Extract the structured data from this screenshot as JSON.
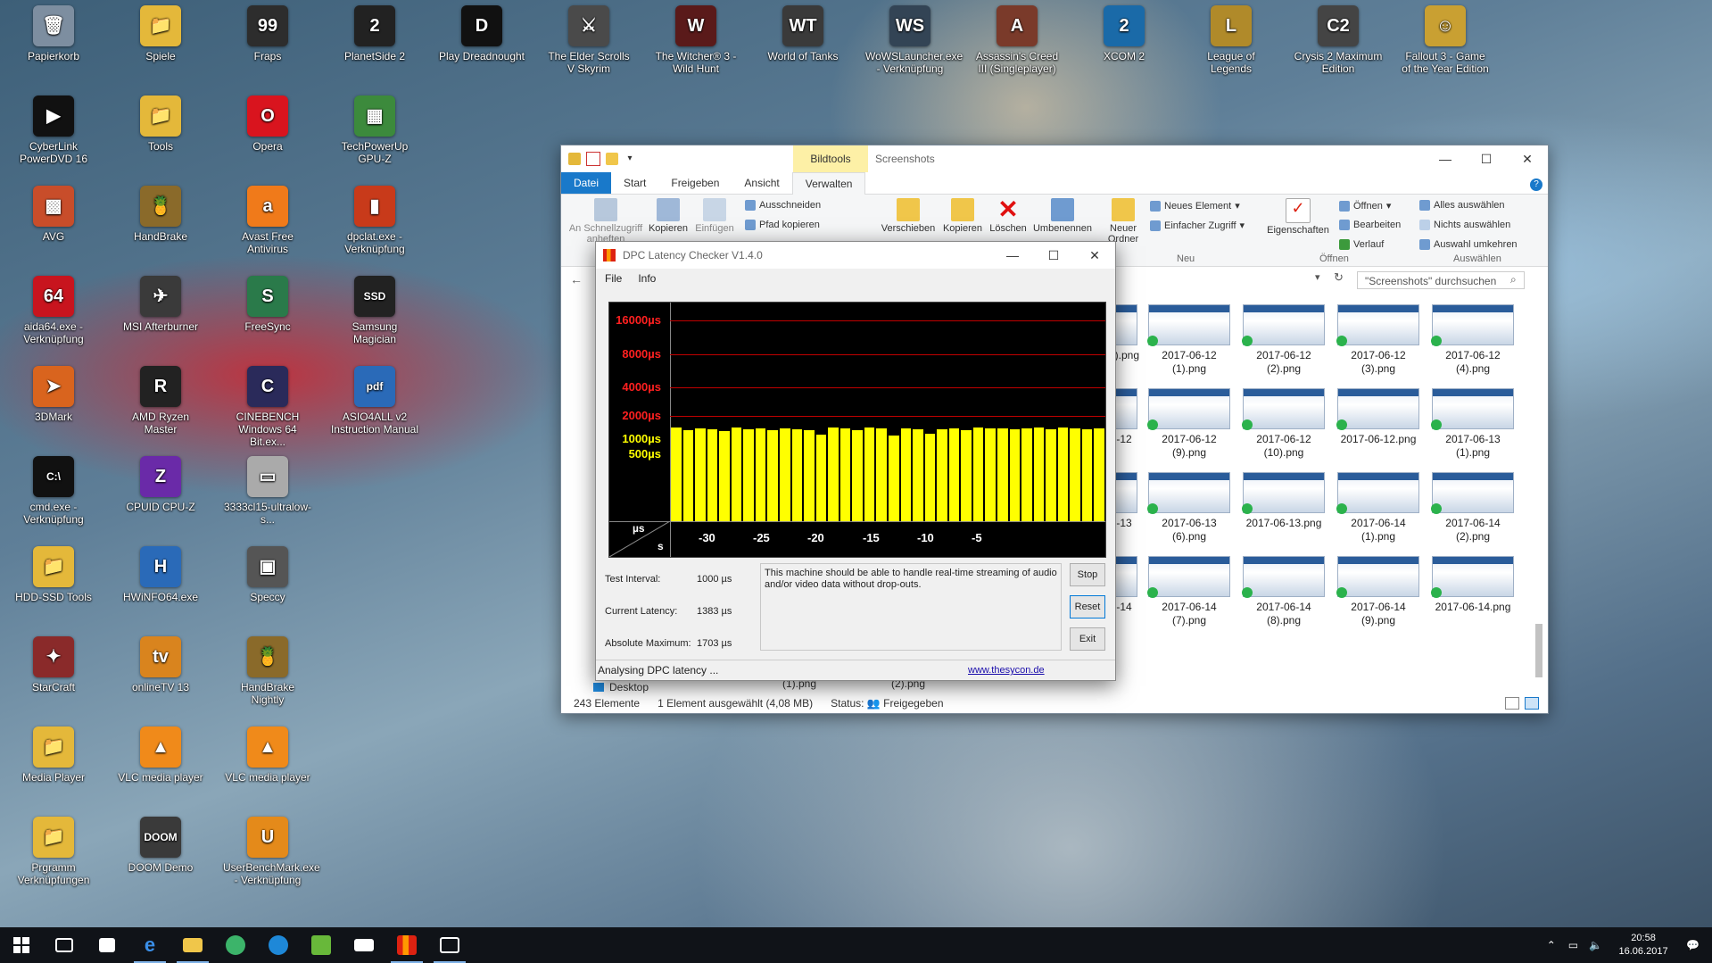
{
  "desktop_icons": [
    {
      "label": "Papierkorb",
      "glyph": "🗑",
      "color": "#7d8ea0"
    },
    {
      "label": "Spiele",
      "glyph": "📁",
      "color": "#e4b83a"
    },
    {
      "label": "Fraps",
      "glyph": "99",
      "color": "#2d2d2d"
    },
    {
      "label": "PlanetSide 2",
      "glyph": "2",
      "color": "#222"
    },
    {
      "label": "Play Dreadnought",
      "glyph": "D",
      "color": "#111"
    },
    {
      "label": "The Elder Scrolls V Skyrim",
      "glyph": "⚔",
      "color": "#4a4a4a"
    },
    {
      "label": "The Witcher® 3 - Wild Hunt",
      "glyph": "W",
      "color": "#5a1a1a"
    },
    {
      "label": "World of Tanks",
      "glyph": "WT",
      "color": "#3a3a3a"
    },
    {
      "label": "WoWSLauncher.exe - Verknüpfung",
      "glyph": "WS",
      "color": "#334455"
    },
    {
      "label": "Assassin's Creed III (Singleplayer)",
      "glyph": "A",
      "color": "#7a3a2a"
    },
    {
      "label": "XCOM 2",
      "glyph": "2",
      "color": "#1a6aa8"
    },
    {
      "label": "League of Legends",
      "glyph": "L",
      "color": "#b08a2a"
    },
    {
      "label": "Crysis 2 Maximum Edition",
      "glyph": "C2",
      "color": "#444"
    },
    {
      "label": "Fallout 3 - Game of the Year Edition",
      "glyph": "☺",
      "color": "#c9a032"
    },
    {
      "label": "CyberLink PowerDVD 16",
      "glyph": "▶",
      "color": "#111"
    },
    {
      "label": "Tools",
      "glyph": "📁",
      "color": "#e4b83a"
    },
    {
      "label": "Opera",
      "glyph": "O",
      "color": "#d9141e"
    },
    {
      "label": "TechPowerUp GPU-Z",
      "glyph": "▦",
      "color": "#3c8a3c"
    },
    {
      "label": "AVG",
      "glyph": "▩",
      "color": "#c84d2a"
    },
    {
      "label": "HandBrake",
      "glyph": "🍍",
      "color": "#8a6a2a"
    },
    {
      "label": "Avast Free Antivirus",
      "glyph": "a",
      "color": "#f07a1a"
    },
    {
      "label": "dpclat.exe - Verknüpfung",
      "glyph": "▮",
      "color": "#c83a1a"
    },
    {
      "label": "aida64.exe - Verknüpfung",
      "glyph": "64",
      "color": "#c8141e"
    },
    {
      "label": "MSI Afterburner",
      "glyph": "✈",
      "color": "#3a3a3a"
    },
    {
      "label": "FreeSync",
      "glyph": "S",
      "color": "#2a7a4a"
    },
    {
      "label": "Samsung Magician",
      "glyph": "SSD",
      "color": "#222"
    },
    {
      "label": "3DMark",
      "glyph": "➤",
      "color": "#d9641e"
    },
    {
      "label": "AMD Ryzen Master",
      "glyph": "R",
      "color": "#222"
    },
    {
      "label": "CINEBENCH Windows 64 Bit.ex...",
      "glyph": "C",
      "color": "#2a2a5a"
    },
    {
      "label": "ASIO4ALL v2 Instruction Manual",
      "glyph": "pdf",
      "color": "#2a6ab8"
    },
    {
      "label": "cmd.exe - Verknüpfung",
      "glyph": "C:\\",
      "color": "#111"
    },
    {
      "label": "CPUID CPU-Z",
      "glyph": "Z",
      "color": "#6a2aa8"
    },
    {
      "label": "3333cl15-ultralow-s...",
      "glyph": "▭",
      "color": "#aaaaaa"
    },
    {
      "label": "HDD-SSD Tools",
      "glyph": "📁",
      "color": "#e4b83a"
    },
    {
      "label": "HWiNFO64.exe",
      "glyph": "H",
      "color": "#2a6ab8"
    },
    {
      "label": "Speccy",
      "glyph": "▣",
      "color": "#555"
    },
    {
      "label": "StarCraft",
      "glyph": "✦",
      "color": "#8a2a2a"
    },
    {
      "label": "onlineTV 13",
      "glyph": "tv",
      "color": "#d9841e"
    },
    {
      "label": "HandBrake Nightly",
      "glyph": "🍍",
      "color": "#8a6a2a"
    },
    {
      "label": "Media Player",
      "glyph": "📁",
      "color": "#e4b83a"
    },
    {
      "label": "VLC media player",
      "glyph": "▲",
      "color": "#f08a1a"
    },
    {
      "label": "VLC media player",
      "glyph": "▲",
      "color": "#f08a1a"
    },
    {
      "label": "Prgramm Verknüpfungen",
      "glyph": "📁",
      "color": "#e4b83a"
    },
    {
      "label": "DOOM Demo",
      "glyph": "DOOM",
      "color": "#3a3a3a"
    },
    {
      "label": "UserBenchMark.exe - Verknüpfung",
      "glyph": "U",
      "color": "#e48a1a"
    }
  ],
  "explorer": {
    "context_tab": "Bildtools",
    "title": "Screenshots",
    "tabs": [
      "Datei",
      "Start",
      "Freigeben",
      "Ansicht",
      "Verwalten"
    ],
    "ribbon": {
      "pin": "An Schnellzugriff anheften",
      "copy": "Kopieren",
      "paste": "Einfügen",
      "cut": "Ausschneiden",
      "copy_path": "Pfad kopieren",
      "move": "Verschieben",
      "copy_to": "Kopieren",
      "delete": "Löschen",
      "rename": "Umbenennen",
      "new_folder": "Neuer Ordner",
      "new_item": "Neues Element",
      "easy_access": "Einfacher Zugriff",
      "group_new": "Neu",
      "properties": "Eigenschaften",
      "open": "Öffnen",
      "edit": "Bearbeiten",
      "history": "Verlauf",
      "group_open": "Öffnen",
      "select_all": "Alles auswählen",
      "select_none": "Nichts auswählen",
      "invert": "Auswahl umkehren",
      "group_select": "Auswählen"
    },
    "search_placeholder": "\"Screenshots\" durchsuchen",
    "thumbs": [
      {
        "label": "1).png",
        "row": 0,
        "col": -1
      },
      {
        "label": "2017-06-12 (1).png",
        "row": 0,
        "col": 0
      },
      {
        "label": "2017-06-12 (2).png",
        "row": 0,
        "col": 1
      },
      {
        "label": "2017-06-12 (3).png",
        "row": 0,
        "col": 2
      },
      {
        "label": "2017-06-12 (4).png",
        "row": 0,
        "col": 3
      },
      {
        "label": "-12",
        "row": 1,
        "col": -1
      },
      {
        "label": "2017-06-12 (9).png",
        "row": 1,
        "col": 0
      },
      {
        "label": "2017-06-12 (10).png",
        "row": 1,
        "col": 1
      },
      {
        "label": "2017-06-12.png",
        "row": 1,
        "col": 2
      },
      {
        "label": "2017-06-13 (1).png",
        "row": 1,
        "col": 3
      },
      {
        "label": "-13",
        "row": 2,
        "col": -1
      },
      {
        "label": "2017-06-13 (6).png",
        "row": 2,
        "col": 0
      },
      {
        "label": "2017-06-13.png",
        "row": 2,
        "col": 1
      },
      {
        "label": "2017-06-14 (1).png",
        "row": 2,
        "col": 2
      },
      {
        "label": "2017-06-14 (2).png",
        "row": 2,
        "col": 3
      },
      {
        "label": "-14",
        "row": 3,
        "col": -1
      },
      {
        "label": "2017-06-14 (7).png",
        "row": 3,
        "col": 0
      },
      {
        "label": "2017-06-14 (8).png",
        "row": 3,
        "col": 1
      },
      {
        "label": "2017-06-14 (9).png",
        "row": 3,
        "col": 2
      },
      {
        "label": "2017-06-14.png",
        "row": 3,
        "col": 3
      }
    ],
    "nav_desktop": "Desktop",
    "behind_1": "(1).png",
    "behind_2": "(2).png",
    "status_count": "243 Elemente",
    "status_selected": "1 Element ausgewählt (4,08 MB)",
    "status_share": "Status: 👥 Freigegeben"
  },
  "dpc": {
    "title": "DPC Latency Checker V1.4.0",
    "menu": [
      "File",
      "Info"
    ],
    "y_ticks": [
      {
        "label": "16000µs",
        "color": "#ff2020"
      },
      {
        "label": "8000µs",
        "color": "#ff2020"
      },
      {
        "label": "4000µs",
        "color": "#ff2020"
      },
      {
        "label": "2000µs",
        "color": "#ff2020"
      },
      {
        "label": "1000µs",
        "color": "#ffff00"
      },
      {
        "label": "500µs",
        "color": "#ffff00"
      }
    ],
    "x_ticks": [
      "-30",
      "-25",
      "-20",
      "-15",
      "-10",
      "-5"
    ],
    "corner_top": "µs",
    "corner_bottom": "s",
    "bar_values": [
      1420,
      1300,
      1380,
      1350,
      1280,
      1400,
      1330,
      1370,
      1290,
      1380,
      1340,
      1300,
      1150,
      1400,
      1390,
      1310,
      1400,
      1360,
      1120,
      1380,
      1330,
      1180,
      1340,
      1370,
      1300,
      1400,
      1390,
      1360,
      1350,
      1380,
      1400,
      1330,
      1410,
      1380,
      1350,
      1380
    ],
    "test_interval_label": "Test Interval:",
    "test_interval": "1000 µs",
    "current_latency_label": "Current Latency:",
    "current_latency": "1383 µs",
    "abs_max_label": "Absolute Maximum:",
    "abs_max": "1703 µs",
    "message": "This machine should be able to handle real-time streaming of audio and/or video data without drop-outs.",
    "btn_stop": "Stop",
    "btn_reset": "Reset",
    "btn_exit": "Exit",
    "status": "Analysing DPC latency ...",
    "link": "www.thesycon.de"
  },
  "taskbar": {
    "time": "20:58",
    "date": "16.06.2017"
  }
}
